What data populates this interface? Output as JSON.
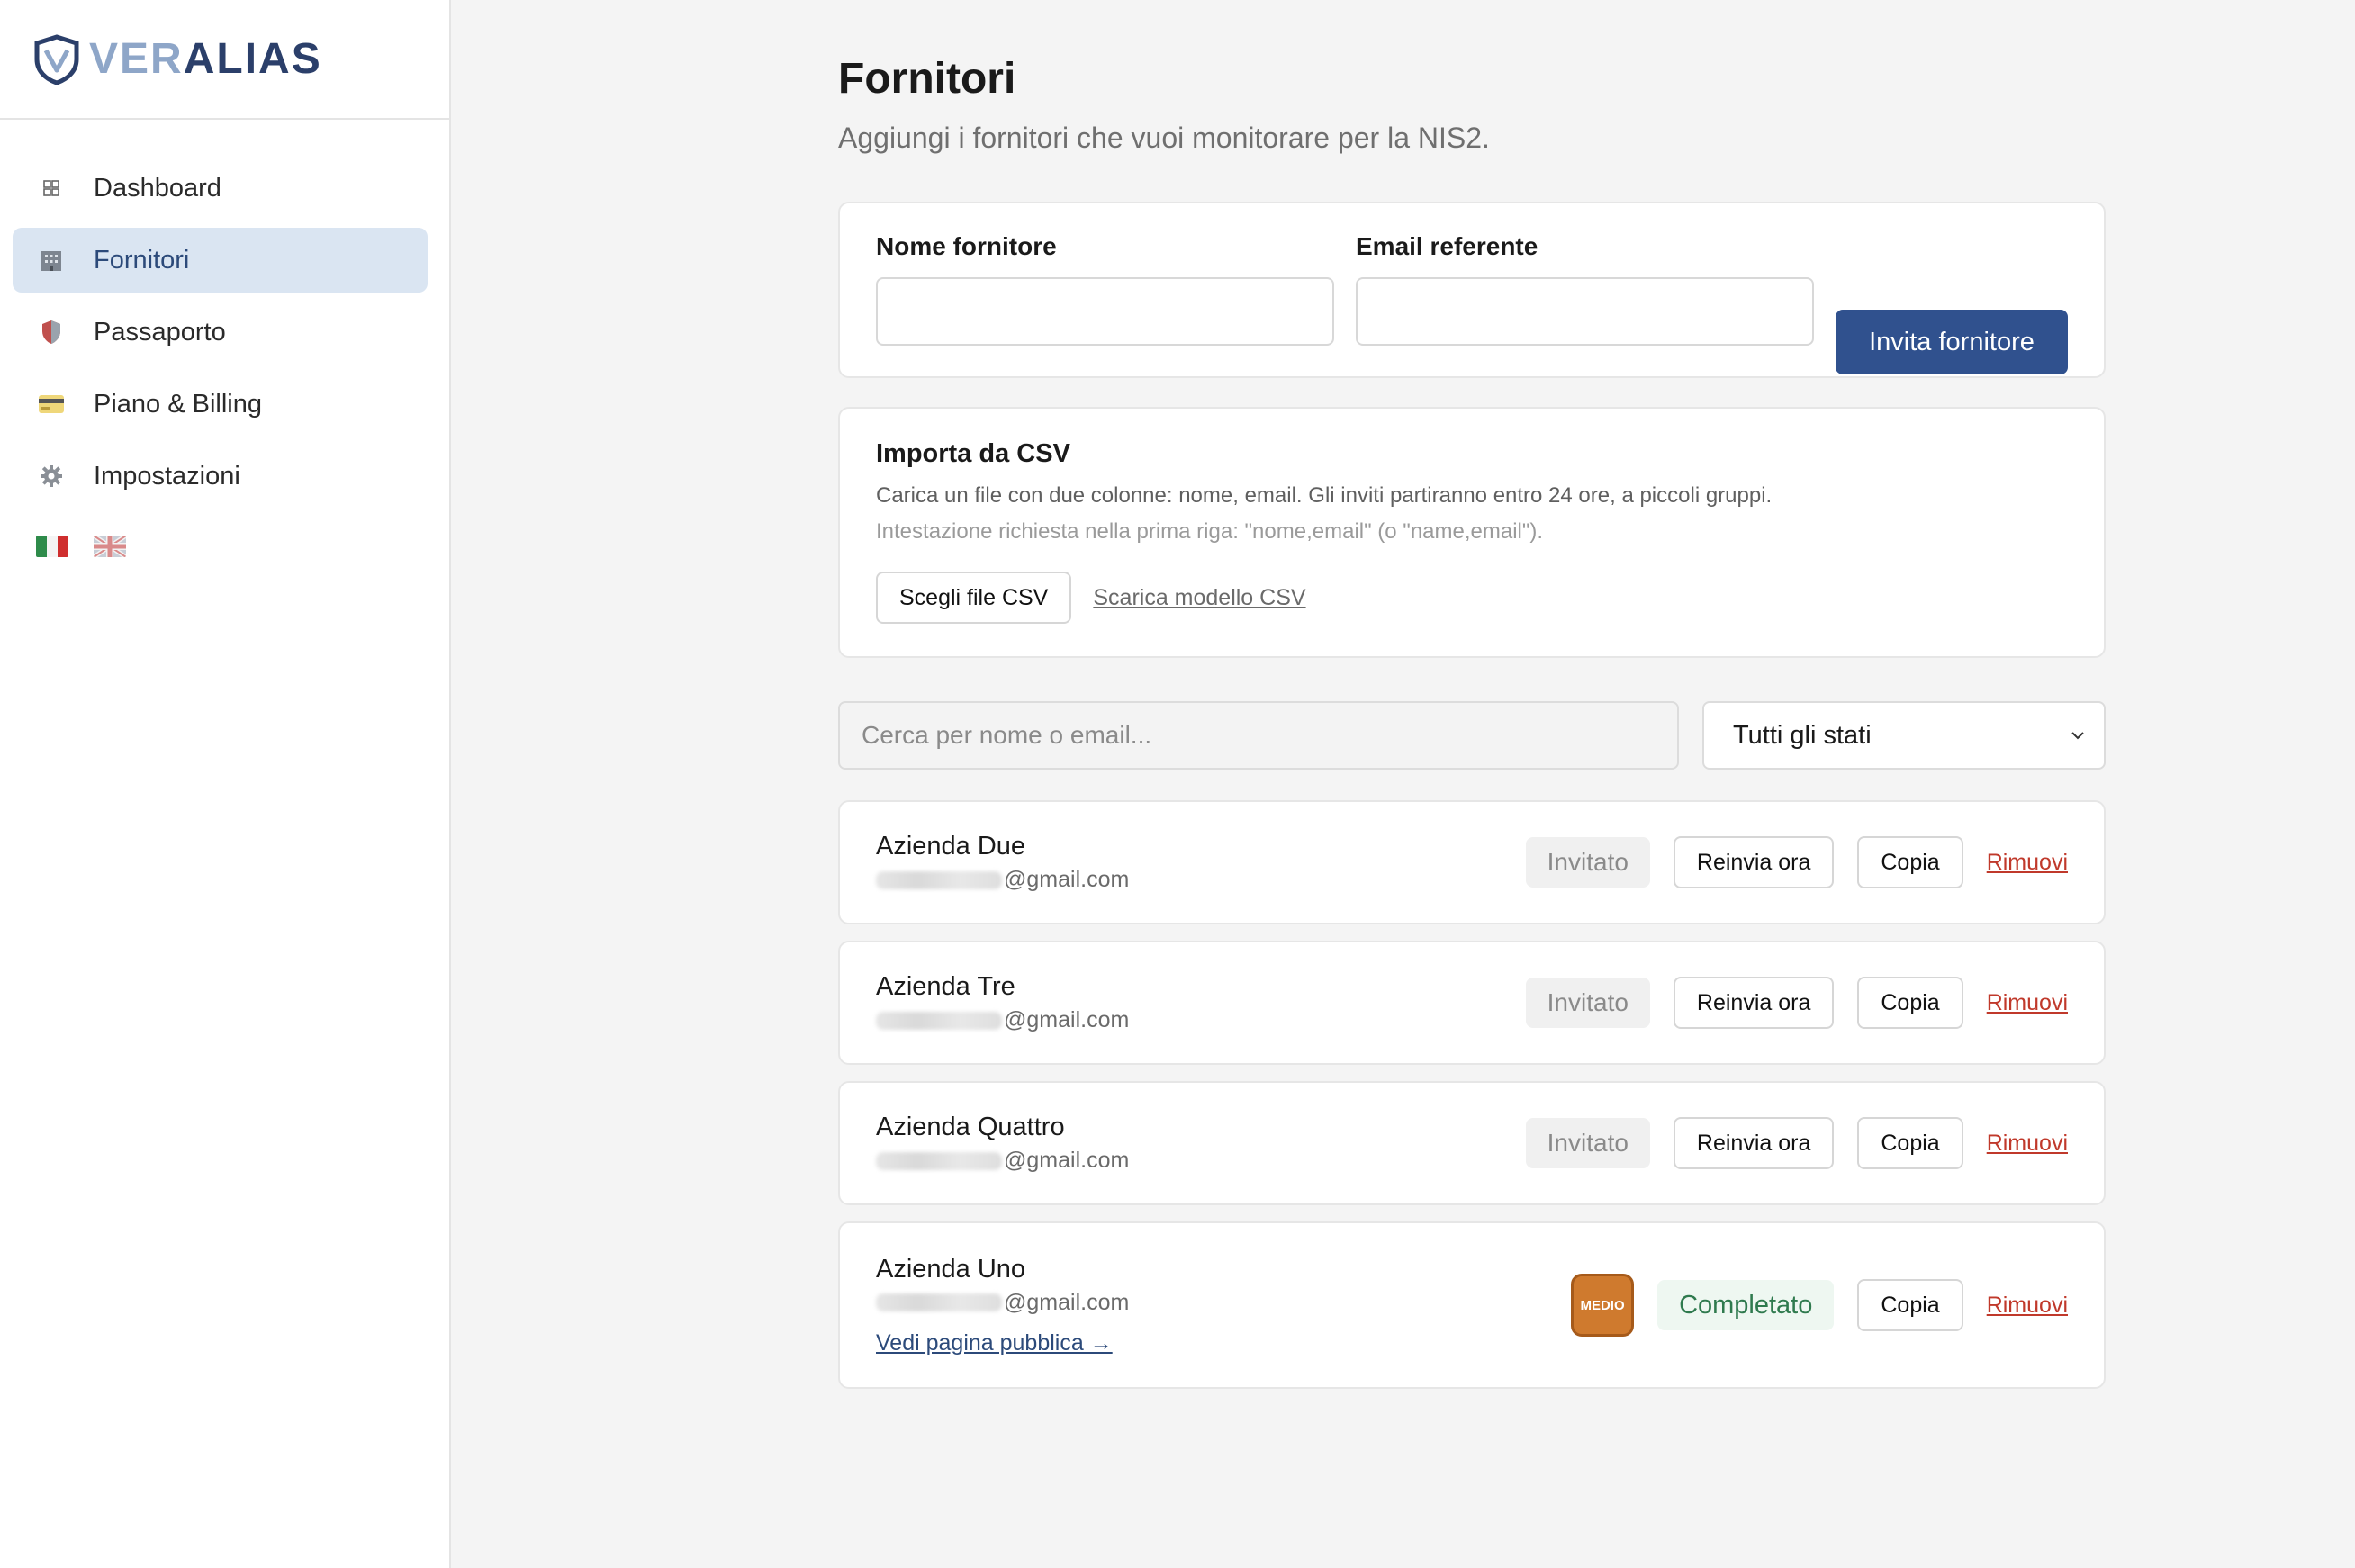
{
  "brand": {
    "ver": "VER",
    "alias": "ALIAS"
  },
  "sidebar": {
    "items": [
      {
        "label": "Dashboard",
        "icon": "grid-icon"
      },
      {
        "label": "Fornitori",
        "icon": "building-icon",
        "active": true
      },
      {
        "label": "Passaporto",
        "icon": "shield-icon"
      },
      {
        "label": "Piano & Billing",
        "icon": "credit-card-icon"
      },
      {
        "label": "Impostazioni",
        "icon": "gear-icon"
      }
    ],
    "languages": [
      "it-flag-icon",
      "uk-flag-icon"
    ]
  },
  "page": {
    "title": "Fornitori",
    "subtitle": "Aggiungi i fornitori che vuoi monitorare per la NIS2."
  },
  "invite": {
    "name_label": "Nome fornitore",
    "name_value": "",
    "email_label": "Email referente",
    "email_value": "",
    "submit_label": "Invita fornitore"
  },
  "csv": {
    "title": "Importa da CSV",
    "description": "Carica un file con due colonne: nome, email. Gli inviti partiranno entro 24 ore, a piccoli gruppi.",
    "hint": "Intestazione richiesta nella prima riga: \"nome,email\" (o \"name,email\").",
    "choose_label": "Scegli file CSV",
    "template_label": "Scarica modello CSV"
  },
  "filters": {
    "search_placeholder": "Cerca per nome o email...",
    "status_selected": "Tutti gli stati"
  },
  "suppliers": [
    {
      "name": "Azienda Due",
      "email_domain": "@gmail.com",
      "status": "Invitato",
      "resend": "Reinvia ora",
      "copy": "Copia",
      "remove": "Rimuovi"
    },
    {
      "name": "Azienda Tre",
      "email_domain": "@gmail.com",
      "status": "Invitato",
      "resend": "Reinvia ora",
      "copy": "Copia",
      "remove": "Rimuovi"
    },
    {
      "name": "Azienda Quattro",
      "email_domain": "@gmail.com",
      "status": "Invitato",
      "resend": "Reinvia ora",
      "copy": "Copia",
      "remove": "Rimuovi"
    },
    {
      "name": "Azienda Uno",
      "email_domain": "@gmail.com",
      "public_link": "Vedi pagina pubblica →",
      "risk_badge": "MEDIO",
      "status": "Completato",
      "copy": "Copia",
      "remove": "Rimuovi"
    }
  ],
  "colors": {
    "primary": "#30518e",
    "active_nav": "#dae5f2",
    "success": "#2f7a4e",
    "danger": "#c0392b",
    "badge_medio": "#cf7a2e"
  }
}
